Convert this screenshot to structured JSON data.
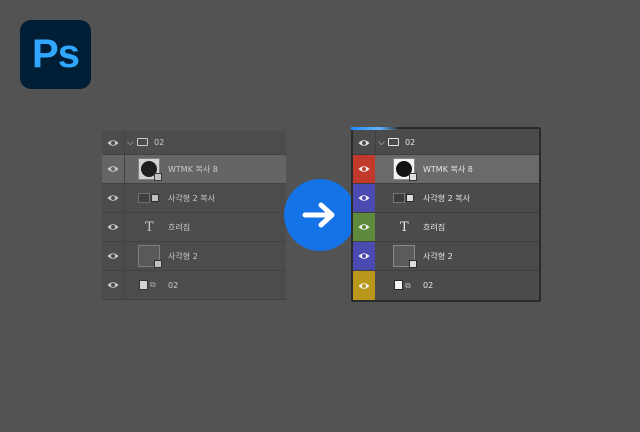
{
  "app": {
    "logo_text": "Ps",
    "logo_bg": "#001e36",
    "logo_color": "#31a8ff"
  },
  "arrow": {
    "icon": "right-arrow-icon",
    "color": "#1473e6"
  },
  "panels": {
    "before": {
      "group_name": "02",
      "layers": [
        {
          "name": "WTMK 복사 8",
          "type": "smart-object",
          "selected": true
        },
        {
          "name": "사각형 2 복사",
          "type": "shape"
        },
        {
          "name": "흐려짐",
          "type": "text"
        },
        {
          "name": "사각형 2",
          "type": "shape"
        },
        {
          "name": "02",
          "type": "smart-object"
        }
      ]
    },
    "after": {
      "group_name": "02",
      "layers": [
        {
          "name": "WTMK 복사 8",
          "type": "smart-object",
          "selected": true,
          "color": "#c0392b"
        },
        {
          "name": "사각형 2 복사",
          "type": "shape",
          "color": "#4a4ab0"
        },
        {
          "name": "흐려짐",
          "type": "text",
          "color": "#5e8a3c"
        },
        {
          "name": "사각형 2",
          "type": "shape",
          "color": "#4a4ab0"
        },
        {
          "name": "02",
          "type": "smart-object",
          "color": "#b8971a"
        }
      ]
    }
  },
  "thumb_text": "T.!"
}
